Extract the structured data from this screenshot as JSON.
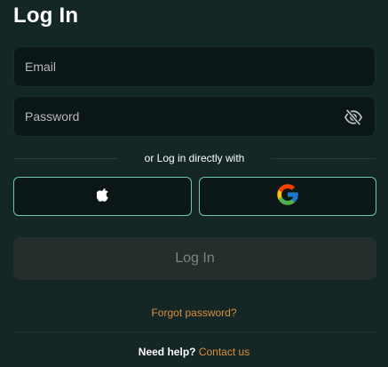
{
  "header": {
    "title": "Log In"
  },
  "form": {
    "email_placeholder": "Email",
    "password_placeholder": "Password",
    "password_visibility_icon": "eye-off-icon"
  },
  "social": {
    "divider_text": "or Log in directly with",
    "providers": [
      {
        "name": "Apple",
        "icon": "apple-icon"
      },
      {
        "name": "Google",
        "icon": "google-icon"
      }
    ],
    "border_color": "#6fc7a3"
  },
  "actions": {
    "login_label": "Log In",
    "forgot_label": "Forgot password?"
  },
  "help": {
    "text": "Need help?",
    "link_label": "Contact us"
  },
  "colors": {
    "background": "#142625",
    "accent_link": "#dc8f3a",
    "button_disabled_bg": "#252e2d",
    "button_disabled_text": "#7c8584"
  }
}
